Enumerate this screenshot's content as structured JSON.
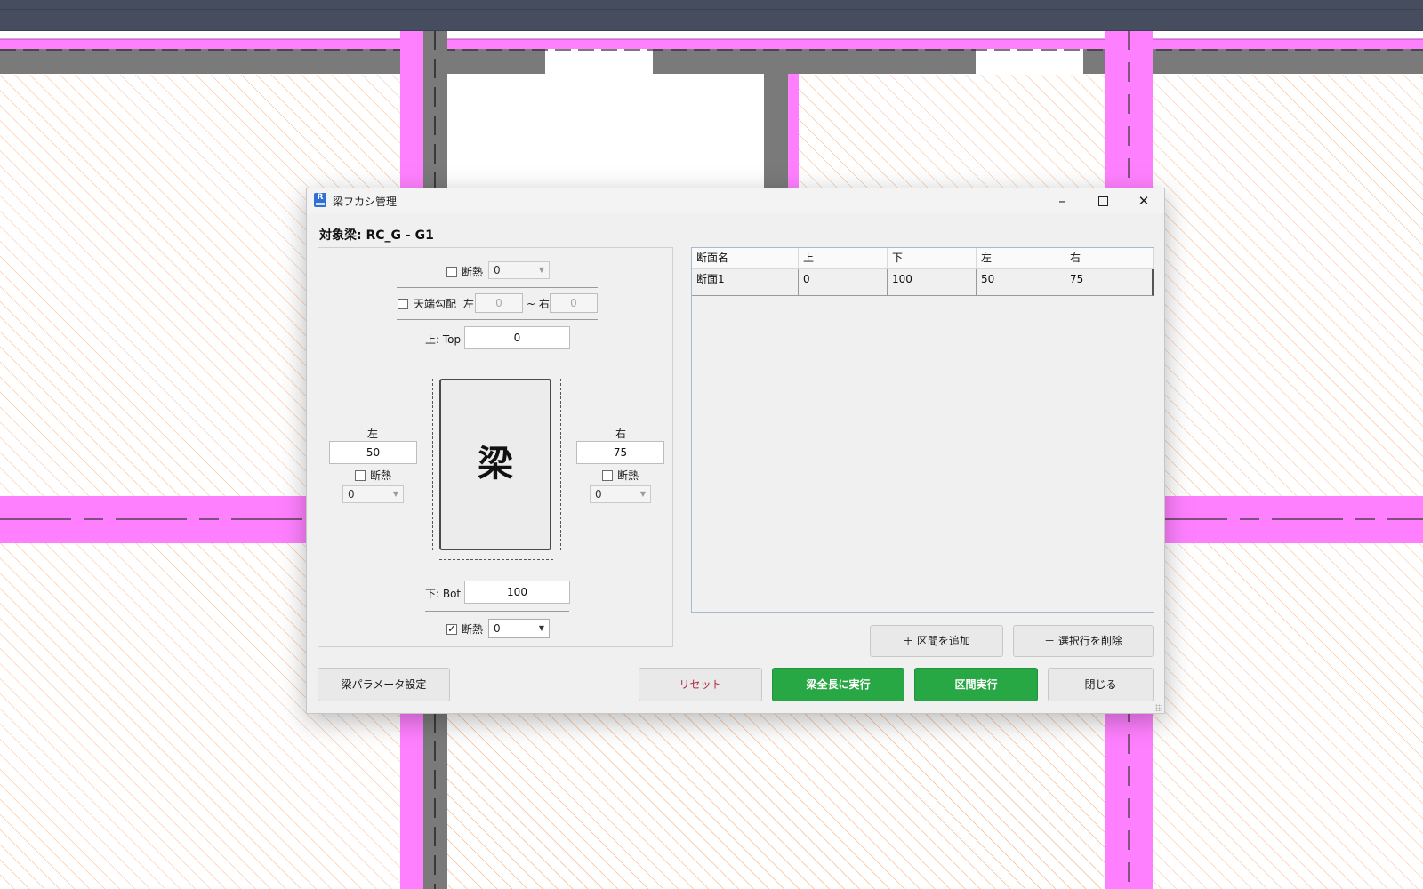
{
  "colors": {
    "beam_magenta": "#ff80ff",
    "wall_gray": "#7a7a7a",
    "hatch_orange": "#f6b78a",
    "accent_green": "#28a745",
    "reset_red": "#b02842",
    "topbar": "#454d5e"
  },
  "dialog": {
    "title": "梁フカシ管理",
    "app_icon_letter": "R",
    "icon": "revit-app-icon",
    "window_controls": {
      "minimize": "–",
      "maximize": "",
      "close": "✕"
    },
    "target_beam": "対象梁: RC_G - G1"
  },
  "editor": {
    "top_insulation": {
      "label": "断熱",
      "checked": false,
      "value": "0"
    },
    "slope": {
      "label": "天端勾配",
      "left_label": "左",
      "left_value": "0",
      "tilde_right_label": "~ 右",
      "right_value": "0",
      "checked": false
    },
    "top": {
      "label": "上: Top",
      "value": "0"
    },
    "left": {
      "label": "左",
      "value": "50",
      "insulation_label": "断熱",
      "insulation_checked": false,
      "insulation_value": "0"
    },
    "right": {
      "label": "右",
      "value": "75",
      "insulation_label": "断熱",
      "insulation_checked": false,
      "insulation_value": "0"
    },
    "beam_glyph": "梁",
    "bottom": {
      "label": "下: Bot",
      "value": "100"
    },
    "bottom_insulation": {
      "label": "断熱",
      "checked": true,
      "value": "0"
    }
  },
  "table": {
    "columns": [
      "断面名",
      "上",
      "下",
      "左",
      "右"
    ],
    "rows": [
      [
        "断面1",
        "0",
        "100",
        "50",
        "75"
      ]
    ]
  },
  "buttons": {
    "add_section": "＋ 区間を追加",
    "delete_row": "－ 選択行を削除",
    "beam_params": "梁パラメータ設定",
    "reset": "リセット",
    "run_full": "梁全長に実行",
    "run_section": "区間実行",
    "close": "閉じる"
  }
}
